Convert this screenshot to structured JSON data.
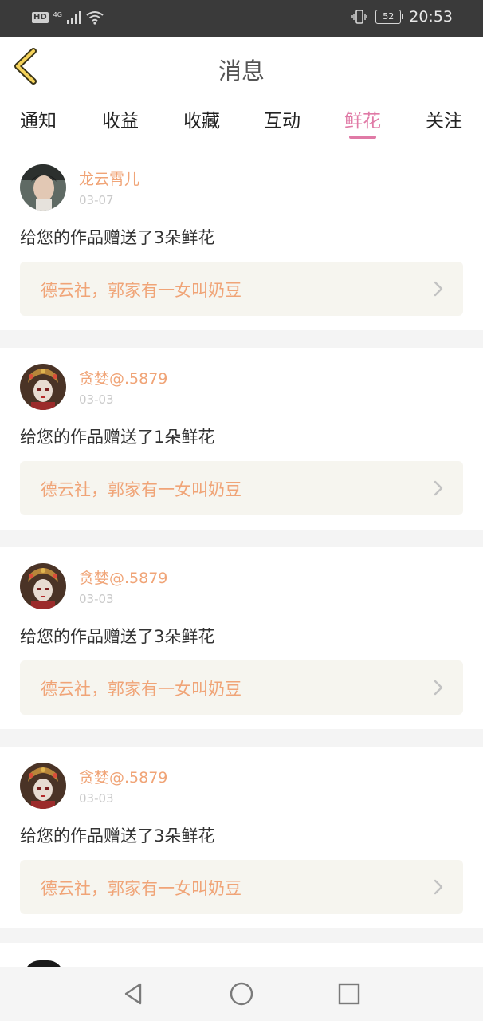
{
  "status_bar": {
    "hd": "HD",
    "network": "4G",
    "battery": "52",
    "time": "20:53"
  },
  "header": {
    "title": "消息",
    "back_icon": "chevron-left-icon"
  },
  "tabs": [
    {
      "label": "通知"
    },
    {
      "label": "收益"
    },
    {
      "label": "收藏"
    },
    {
      "label": "互动"
    },
    {
      "label": "鲜花",
      "active": true
    },
    {
      "label": "关注"
    }
  ],
  "colors": {
    "accent_pink": "#e07aa6",
    "username_orange": "#f0a477",
    "link_bg": "#f6f5ef"
  },
  "messages": [
    {
      "username": "龙云霄儿",
      "date": "03-07",
      "text": "给您的作品赠送了3朵鲜花",
      "work_title": "德云社，郭家有一女叫奶豆"
    },
    {
      "username": "贪婪@.5879",
      "date": "03-03",
      "text": "给您的作品赠送了1朵鲜花",
      "work_title": "德云社，郭家有一女叫奶豆"
    },
    {
      "username": "贪婪@.5879",
      "date": "03-03",
      "text": "给您的作品赠送了3朵鲜花",
      "work_title": "德云社，郭家有一女叫奶豆"
    },
    {
      "username": "贪婪@.5879",
      "date": "03-03",
      "text": "给您的作品赠送了3朵鲜花",
      "work_title": "德云社，郭家有一女叫奶豆"
    }
  ]
}
